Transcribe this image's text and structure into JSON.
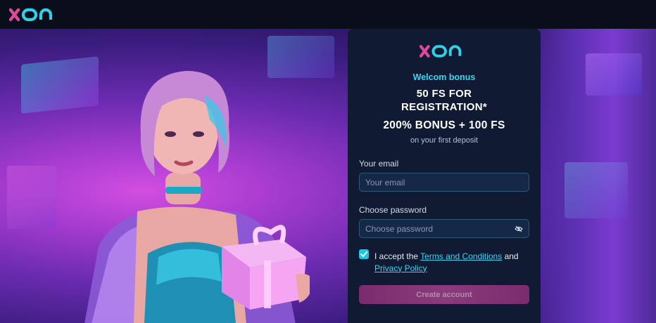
{
  "header": {
    "logo_text": "xon"
  },
  "panel": {
    "logo_text": "xon",
    "bonus_title": "Welcom bonus",
    "bonus_line1": "50 FS FOR",
    "bonus_line2": "REGISTRATION*",
    "bonus_line3": "200% BONUS + 100 FS",
    "bonus_note": "on your first deposit"
  },
  "form": {
    "email_label": "Your email",
    "email_placeholder": "Your email",
    "email_value": "",
    "password_label": "Choose password",
    "password_placeholder": "Choose password",
    "password_value": "",
    "accept_prefix": "I accept the",
    "terms_link": "Terms and Conditions",
    "accept_and": "and",
    "privacy_link": "Privacy Policy",
    "accept_checked": true,
    "submit_label": "Create account"
  },
  "icons": {
    "logo": "xon-logo",
    "password_toggle": "eye-slash-icon",
    "checkbox": "checkmark-icon"
  },
  "colors": {
    "accent": "#39d6f2",
    "logo_x": "#e0489e",
    "panel_bg": "#101a33",
    "button": "#7a2c6e"
  }
}
